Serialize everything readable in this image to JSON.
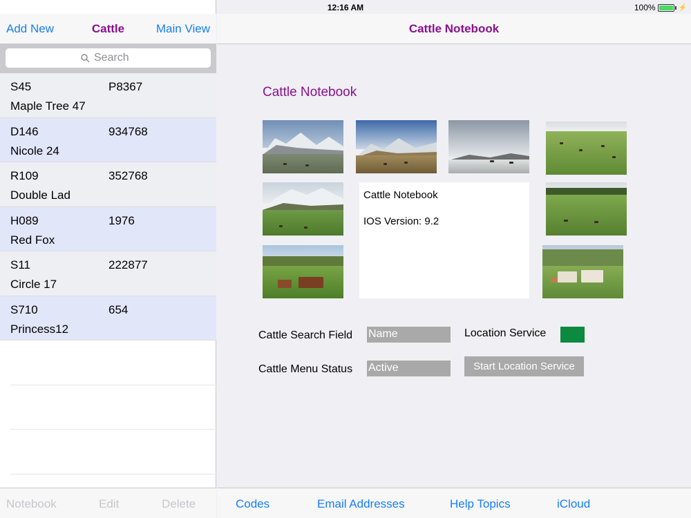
{
  "status_bar": {
    "device": "iPad",
    "time": "12:16 AM",
    "battery": "100%"
  },
  "left_nav": {
    "add_new": "Add New",
    "title": "Cattle",
    "main_view": "Main View"
  },
  "search": {
    "placeholder": "Search"
  },
  "cattle_list": [
    {
      "tag": "S45",
      "id": "P8367",
      "name": "Maple Tree 47"
    },
    {
      "tag": "D146",
      "id": "934768",
      "name": "Nicole 24"
    },
    {
      "tag": "R109",
      "id": "352768",
      "name": "Double Lad"
    },
    {
      "tag": "H089",
      "id": "1976",
      "name": "Red Fox"
    },
    {
      "tag": "S11",
      "id": "222877",
      "name": "Circle 17"
    },
    {
      "tag": "S710",
      "id": "654",
      "name": "Princess12"
    }
  ],
  "left_toolbar": {
    "notebook": "Notebook",
    "edit": "Edit",
    "delete": "Delete"
  },
  "right_nav": {
    "title": "Cattle Notebook"
  },
  "main": {
    "section_title": "Cattle Notebook",
    "info_title": "Cattle Notebook",
    "info_version": "IOS Version:  9.2",
    "search_field_label": "Cattle Search Field",
    "search_field_value": "Name",
    "menu_status_label": "Cattle Menu Status",
    "menu_status_value": "Active",
    "location_service_label": "Location Service",
    "start_location_button": "Start Location Service",
    "location_service_color": "#0b8a40"
  },
  "right_toolbar": {
    "codes": "Codes",
    "email": "Email Addresses",
    "help": "Help Topics",
    "icloud": "iCloud"
  },
  "colors": {
    "accent": "#157efb",
    "title": "#8a0f8f"
  }
}
